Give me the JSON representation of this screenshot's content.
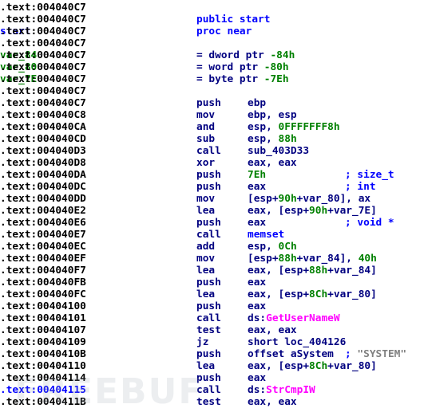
{
  "colors": {
    "address": "#000000",
    "current_address": "#0000ff",
    "label": "#0000ff",
    "var": "#008000",
    "mnemonic": "#000080",
    "number": "#008000",
    "import": "#ff00ff",
    "comment": "#0000ff",
    "string": "#808080"
  },
  "watermark": "FREEBUF",
  "lines": [
    {
      "addr": ".text:004040C7"
    },
    {
      "addr": ".text:004040C7",
      "mn": [
        [
          "public start",
          "b"
        ]
      ]
    },
    {
      "addr": ".text:004040C7",
      "label": [
        "start",
        "b"
      ],
      "mn": [
        [
          "proc near",
          "b"
        ]
      ]
    },
    {
      "addr": ".text:004040C7"
    },
    {
      "addr": ".text:004040C7",
      "label": [
        "var_84",
        "g"
      ],
      "mn": [
        [
          "= dword ptr ",
          "n"
        ],
        [
          "-84h",
          "g"
        ]
      ]
    },
    {
      "addr": ".text:004040C7",
      "label": [
        "var_80",
        "g"
      ],
      "mn": [
        [
          "= word ptr ",
          "n"
        ],
        [
          "-80h",
          "g"
        ]
      ]
    },
    {
      "addr": ".text:004040C7",
      "label": [
        "var_7E",
        "g"
      ],
      "mn": [
        [
          "= byte ptr ",
          "n"
        ],
        [
          "-7Eh",
          "g"
        ]
      ]
    },
    {
      "addr": ".text:004040C7"
    },
    {
      "addr": ".text:004040C7",
      "op": "push",
      "ops": [
        [
          "ebp",
          "n"
        ]
      ]
    },
    {
      "addr": ".text:004040C8",
      "op": "mov",
      "ops": [
        [
          "ebp, esp",
          "n"
        ]
      ]
    },
    {
      "addr": ".text:004040CA",
      "op": "and",
      "ops": [
        [
          "esp, ",
          "n"
        ],
        [
          "0FFFFFFF8h",
          "g"
        ]
      ]
    },
    {
      "addr": ".text:004040CD",
      "op": "sub",
      "ops": [
        [
          "esp, ",
          "n"
        ],
        [
          "88h",
          "g"
        ]
      ]
    },
    {
      "addr": ".text:004040D3",
      "op": "call",
      "ops": [
        [
          "sub_403D33",
          "n"
        ]
      ]
    },
    {
      "addr": ".text:004040D8",
      "op": "xor",
      "ops": [
        [
          "eax, eax",
          "n"
        ]
      ]
    },
    {
      "addr": ".text:004040DA",
      "op": "push",
      "ops": [
        [
          "7Eh",
          "g"
        ]
      ],
      "cmt": [
        [
          "; size_t",
          "b"
        ]
      ]
    },
    {
      "addr": ".text:004040DC",
      "op": "push",
      "ops": [
        [
          "eax",
          "n"
        ]
      ],
      "cmt": [
        [
          "; int",
          "b"
        ]
      ]
    },
    {
      "addr": ".text:004040DD",
      "op": "mov",
      "ops": [
        [
          "[esp+",
          "n"
        ],
        [
          "90h",
          "g"
        ],
        [
          "+var_80",
          "n"
        ],
        [
          "], ax",
          "n"
        ]
      ]
    },
    {
      "addr": ".text:004040E2",
      "op": "lea",
      "ops": [
        [
          "eax, [esp+",
          "n"
        ],
        [
          "90h",
          "g"
        ],
        [
          "+var_7E",
          "n"
        ],
        [
          "]",
          "n"
        ]
      ]
    },
    {
      "addr": ".text:004040E6",
      "op": "push",
      "ops": [
        [
          "eax",
          "n"
        ]
      ],
      "cmt": [
        [
          "; void *",
          "b"
        ]
      ]
    },
    {
      "addr": ".text:004040E7",
      "op": "call",
      "ops": [
        [
          "memset",
          "b"
        ]
      ]
    },
    {
      "addr": ".text:004040EC",
      "op": "add",
      "ops": [
        [
          "esp, ",
          "n"
        ],
        [
          "0Ch",
          "g"
        ]
      ]
    },
    {
      "addr": ".text:004040EF",
      "op": "mov",
      "ops": [
        [
          "[esp+",
          "n"
        ],
        [
          "88h",
          "g"
        ],
        [
          "+var_84], ",
          "n"
        ],
        [
          "40h",
          "g"
        ]
      ]
    },
    {
      "addr": ".text:004040F7",
      "op": "lea",
      "ops": [
        [
          "eax, [esp+",
          "n"
        ],
        [
          "88h",
          "g"
        ],
        [
          "+var_84]",
          "n"
        ]
      ]
    },
    {
      "addr": ".text:004040FB",
      "op": "push",
      "ops": [
        [
          "eax",
          "n"
        ]
      ]
    },
    {
      "addr": ".text:004040FC",
      "op": "lea",
      "ops": [
        [
          "eax, [esp+",
          "n"
        ],
        [
          "8Ch",
          "g"
        ],
        [
          "+var_80]",
          "n"
        ]
      ]
    },
    {
      "addr": ".text:00404100",
      "op": "push",
      "ops": [
        [
          "eax",
          "n"
        ]
      ]
    },
    {
      "addr": ".text:00404101",
      "op": "call",
      "ops": [
        [
          "ds:",
          "n"
        ],
        [
          "GetUserNameW",
          "p"
        ]
      ]
    },
    {
      "addr": ".text:00404107",
      "op": "test",
      "ops": [
        [
          "eax, eax",
          "n"
        ]
      ]
    },
    {
      "addr": ".text:00404109",
      "op": "jz",
      "ops": [
        [
          "short loc_404126",
          "n"
        ]
      ]
    },
    {
      "addr": ".text:0040410B",
      "op": "push",
      "ops": [
        [
          "offset aSystem",
          "n"
        ]
      ],
      "cmt": [
        [
          "; ",
          "b"
        ],
        [
          "\"SYSTEM\"",
          "s"
        ]
      ]
    },
    {
      "addr": ".text:00404110",
      "op": "lea",
      "ops": [
        [
          "eax, [esp+",
          "n"
        ],
        [
          "8Ch",
          "g"
        ],
        [
          "+var_80]",
          "n"
        ]
      ]
    },
    {
      "addr": ".text:00404114",
      "op": "push",
      "ops": [
        [
          "eax",
          "n"
        ]
      ]
    },
    {
      "addr": ".text:00404115",
      "current": true,
      "op": "call",
      "ops": [
        [
          "ds:",
          "n"
        ],
        [
          "StrCmpIW",
          "p"
        ]
      ]
    },
    {
      "addr": ".text:0040411B",
      "op": "test",
      "ops": [
        [
          "eax, eax",
          "n"
        ]
      ]
    }
  ]
}
